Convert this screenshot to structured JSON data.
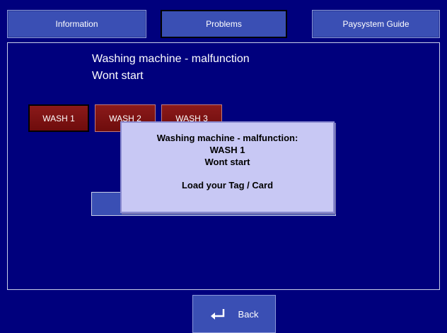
{
  "tabs": {
    "information": "Information",
    "problems": "Problems",
    "paysystem_guide": "Paysystem Guide"
  },
  "heading": {
    "line1": "Washing machine - malfunction",
    "line2": "Wont start"
  },
  "machines": [
    "WASH 1",
    "WASH 2",
    "WASH 3"
  ],
  "dialog": {
    "line1": "Washing machine - malfunction:",
    "line2": "WASH 1",
    "line3": "Wont start",
    "line4": "Load your Tag / Card"
  },
  "back": {
    "label": "Back",
    "icon": "return-arrow-icon"
  },
  "colors": {
    "background": "#00007d",
    "tab": "#3a4fb4",
    "machine_button": "#7a1212",
    "dialog": "#c8c8f4"
  }
}
